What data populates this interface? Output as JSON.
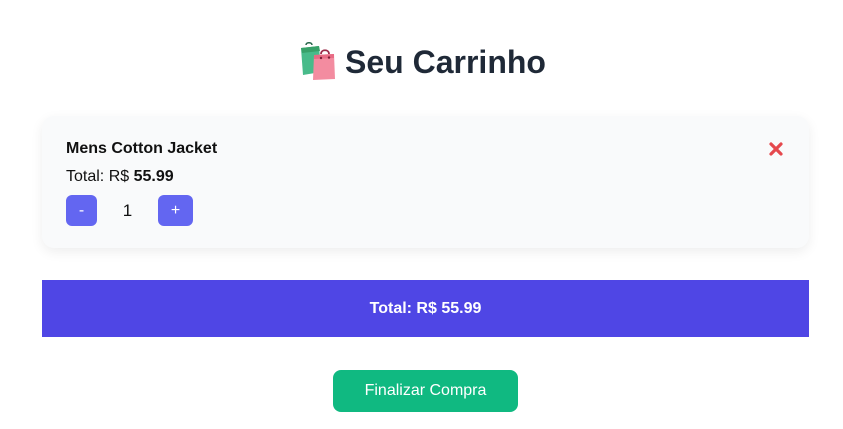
{
  "header": {
    "icon": "shopping-bags-icon",
    "title": "Seu Carrinho"
  },
  "cart": {
    "items": [
      {
        "name": "Mens Cotton Jacket",
        "total_label": "Total: R$",
        "total_value": "55.99",
        "quantity": "1",
        "decrease_label": "-",
        "increase_label": "+",
        "remove_icon": "close-x-icon"
      }
    ]
  },
  "summary": {
    "total_text": "Total: R$ 55.99"
  },
  "actions": {
    "checkout_label": "Finalizar Compra"
  },
  "colors": {
    "accent": "#6366f1",
    "total_bar": "#4f46e5",
    "checkout": "#10b981",
    "remove": "#e5484d",
    "card_bg": "#f9fafb"
  }
}
